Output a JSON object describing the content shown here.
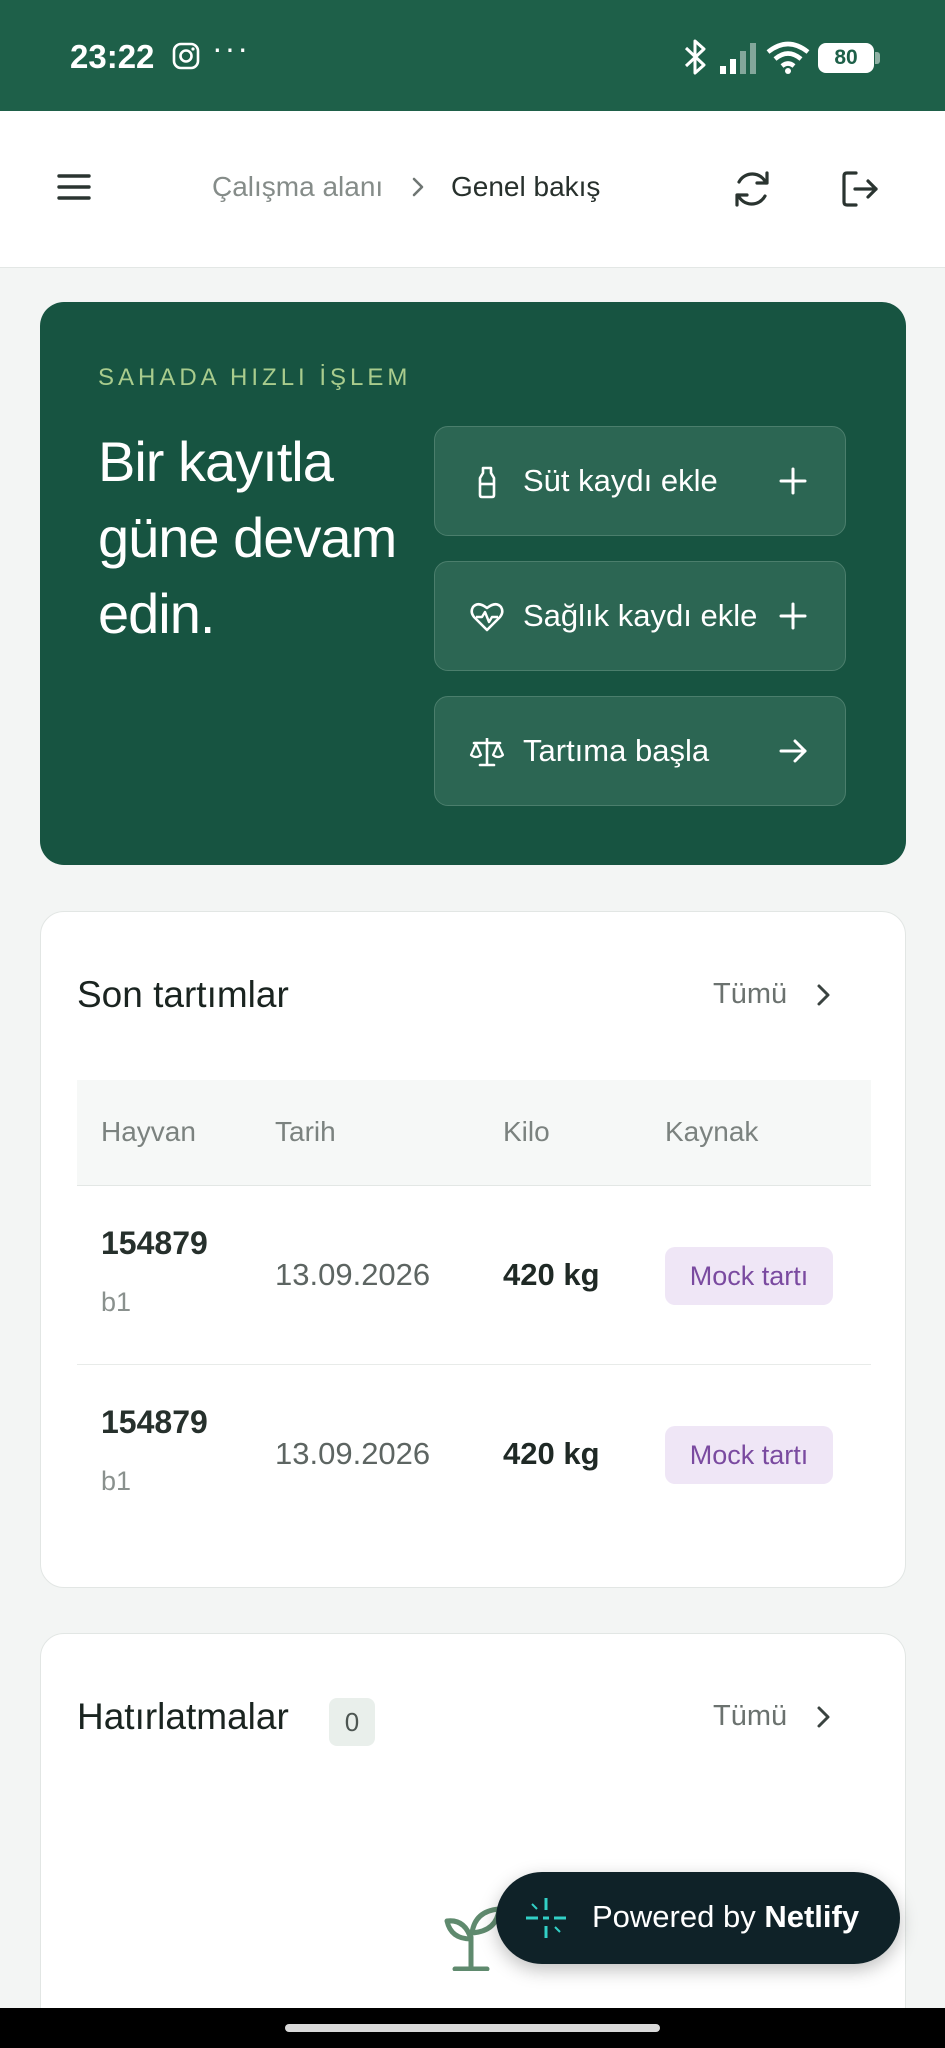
{
  "status_bar": {
    "time": "23:22",
    "dots": "···",
    "battery": "80"
  },
  "header": {
    "breadcrumb": [
      "Çalışma alanı",
      "Genel bakış"
    ]
  },
  "hero": {
    "eyebrow": "SAHADA HIZLI İŞLEM",
    "headline": "Bir kayıtla güne devam edin.",
    "actions": [
      {
        "label": "Süt kaydı ekle",
        "icon": "milk-bottle-icon",
        "trail": "plus-icon"
      },
      {
        "label": "Sağlık kaydı ekle",
        "icon": "heart-pulse-icon",
        "trail": "plus-icon"
      },
      {
        "label": "Tartıma başla",
        "icon": "scale-icon",
        "trail": "arrow-right-icon"
      }
    ]
  },
  "weighings": {
    "title": "Son tartımlar",
    "more": "Tümü",
    "columns": [
      "Hayvan",
      "Tarih",
      "Kilo",
      "Kaynak"
    ],
    "rows": [
      {
        "animal_id": "154879",
        "animal_sub": "b1",
        "date": "13.09.2026",
        "weight": "420 kg",
        "source": "Mock tartı"
      },
      {
        "animal_id": "154879",
        "animal_sub": "b1",
        "date": "13.09.2026",
        "weight": "420 kg",
        "source": "Mock tartı"
      }
    ]
  },
  "reminders": {
    "title": "Hatırlatmalar",
    "count": "0",
    "more": "Tümü"
  },
  "netlify_badge": {
    "prefix": "Powered by",
    "brand": "Netlify"
  },
  "colors": {
    "primary": "#175441",
    "status_bar": "#1e6049",
    "accent_label": "#a9cc8d",
    "badge_text": "#7a4aa0",
    "badge_bg": "#efe6f6"
  }
}
